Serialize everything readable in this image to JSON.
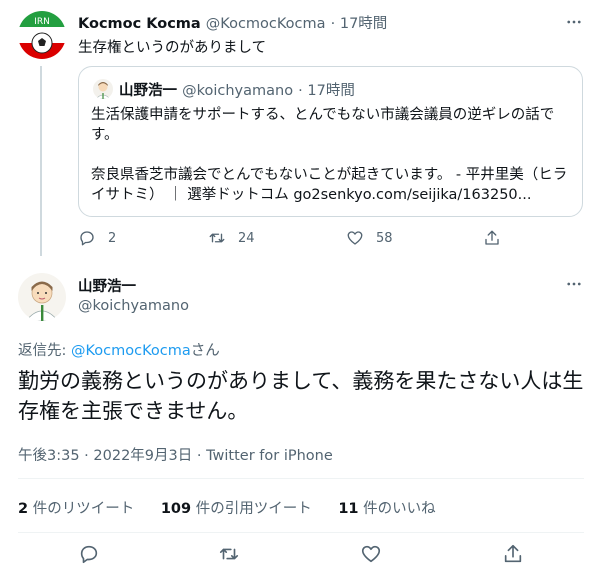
{
  "colors": {
    "accent": "#1d9bf0",
    "text_primary": "#0f1419",
    "text_secondary": "#536471",
    "border": "#cfd9de"
  },
  "tweet1": {
    "display_name": "Kocmoc Kocma",
    "handle": "@KocmocKocma",
    "time": "· 17時間",
    "avatar_text": "IRN",
    "text": "生存権というのがありまして",
    "quote": {
      "display_name": "山野浩一",
      "handle": "@koichyamano",
      "time": "· 17時間",
      "paragraph1": "生活保護申請をサポートする、とんでもない市議会議員の逆ギレの話です。",
      "paragraph2": "奈良県香芝市議会でとんでもないことが起きています。 - 平井里美（ヒライサトミ） ｜ 選挙ドットコム go2senkyo.com/seijika/163250..."
    },
    "actions": {
      "replies": "2",
      "retweets": "24",
      "likes": "58"
    }
  },
  "tweet2": {
    "display_name": "山野浩一",
    "handle": "@koichyamano",
    "reply_prefix": "返信先: ",
    "reply_target": "@KocmocKocma",
    "reply_suffix": "さん",
    "text": "勤労の義務というのがありまして、義務を果たさない人は生存権を主張できません。",
    "timestamp": "午後3:35 · 2022年9月3日 · Twitter for iPhone",
    "stats": {
      "retweets_count": "2",
      "retweets_label": "件のリツイート",
      "quotes_count": "109",
      "quotes_label": "件の引用ツイート",
      "likes_count": "11",
      "likes_label": "件のいいね"
    }
  }
}
